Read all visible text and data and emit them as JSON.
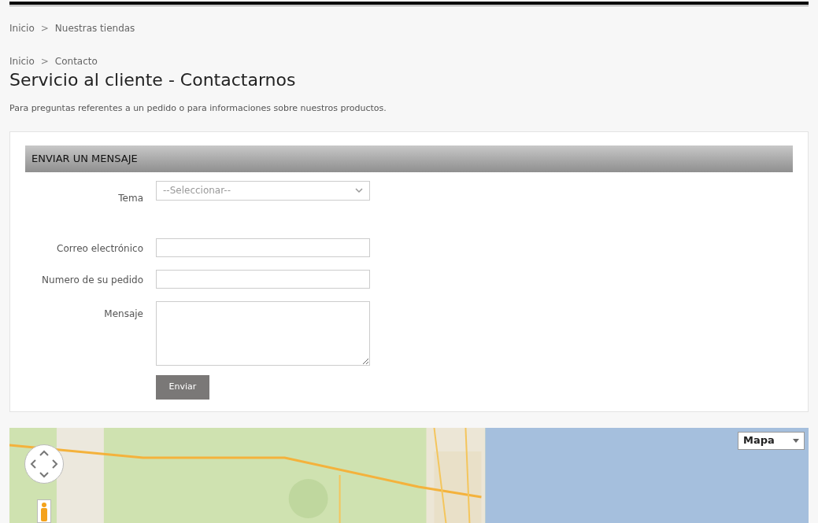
{
  "breadcrumbs": [
    {
      "items": [
        "Inicio",
        "Nuestras tiendas"
      ]
    },
    {
      "items": [
        "Inicio",
        "Contacto"
      ]
    }
  ],
  "separator": ">",
  "title": "Servicio al cliente - Contactarnos",
  "intro": "Para preguntas referentes a un pedido o para informaciones sobre nuestros productos.",
  "form": {
    "heading": "ENVIAR UN MENSAJE",
    "fields": [
      {
        "kind": "select",
        "label": "Tema",
        "placeholder": "--Seleccionar--"
      },
      {
        "kind": "text",
        "label": "Correo electrónico"
      },
      {
        "kind": "text",
        "label": "Numero de su pedido"
      },
      {
        "kind": "textarea",
        "label": "Mensaje"
      }
    ],
    "submit": "Enviar"
  },
  "map": {
    "kind": "picture",
    "type_control": "Mapa"
  }
}
